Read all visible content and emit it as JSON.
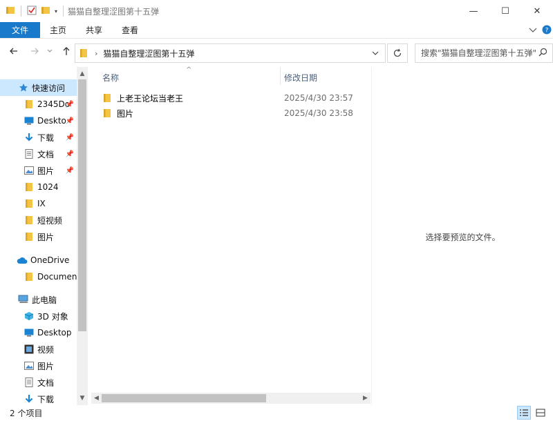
{
  "window": {
    "title": "猫猫自整理涩图第十五弹",
    "minimize_icon": "—",
    "maximize_icon": "☐",
    "close_icon": "✕"
  },
  "ribbon": {
    "tabs": [
      "文件",
      "主页",
      "共享",
      "查看"
    ]
  },
  "address": {
    "path": "猫猫自整理涩图第十五弹",
    "search_placeholder": "搜索\"猫猫自整理涩图第十五弹\""
  },
  "sidebar": {
    "quick_access": "快速访问",
    "quick_items": [
      {
        "label": "2345Do",
        "icon": "folder-icon",
        "pinned": true
      },
      {
        "label": "Deskto",
        "icon": "desktop-icon",
        "pinned": true
      },
      {
        "label": "下载",
        "icon": "download-icon",
        "pinned": true
      },
      {
        "label": "文档",
        "icon": "document-icon",
        "pinned": true
      },
      {
        "label": "图片",
        "icon": "picture-icon",
        "pinned": true
      },
      {
        "label": "1024",
        "icon": "folder-icon",
        "pinned": false
      },
      {
        "label": "IX",
        "icon": "folder-icon",
        "pinned": false
      },
      {
        "label": "短视频",
        "icon": "folder-icon",
        "pinned": false
      },
      {
        "label": "图片",
        "icon": "folder-icon",
        "pinned": false
      }
    ],
    "onedrive": "OneDrive",
    "onedrive_items": [
      {
        "label": "Documen",
        "icon": "folder-icon"
      }
    ],
    "this_pc": "此电脑",
    "pc_items": [
      {
        "label": "3D 对象",
        "icon": "3d-objects-icon"
      },
      {
        "label": "Desktop",
        "icon": "desktop-icon"
      },
      {
        "label": "视频",
        "icon": "video-icon"
      },
      {
        "label": "图片",
        "icon": "picture-icon"
      },
      {
        "label": "文档",
        "icon": "document-icon"
      },
      {
        "label": "下载",
        "icon": "download-icon"
      }
    ]
  },
  "columns": {
    "name": "名称",
    "date": "修改日期"
  },
  "files": [
    {
      "name": "上老王论坛当老王",
      "date": "2025/4/30 23:57",
      "type": "folder"
    },
    {
      "name": "图片",
      "date": "2025/4/30 23:58",
      "type": "folder"
    }
  ],
  "preview": {
    "empty_text": "选择要预览的文件。"
  },
  "status": {
    "item_count": "2 个项目"
  },
  "colors": {
    "accent": "#1979ca",
    "selected": "#cce8ff",
    "folder": "#f4c542"
  }
}
